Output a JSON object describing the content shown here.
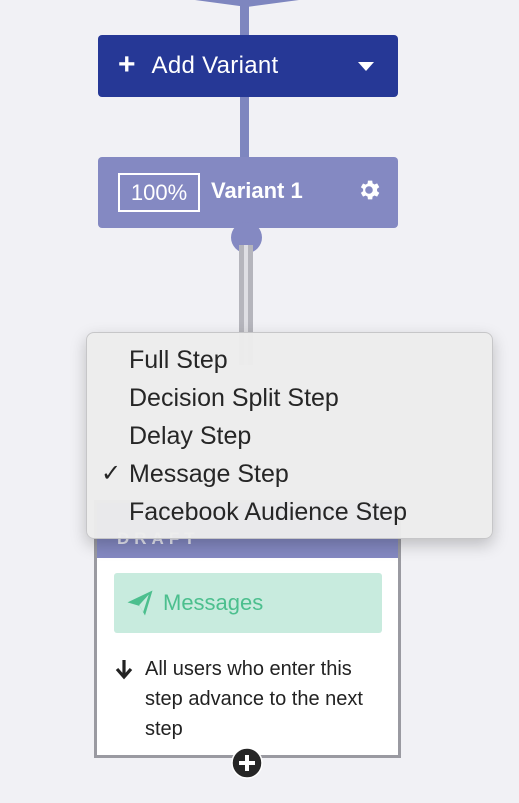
{
  "add_variant": {
    "label": "Add Variant",
    "icon": "plus-icon",
    "dropdown_icon": "caret-down-icon"
  },
  "variant": {
    "percent": "100%",
    "name": "Variant 1",
    "settings_icon": "gear-icon"
  },
  "step_card": {
    "status": "DRAFT",
    "pill_label": "Messages",
    "pill_icon": "paper-plane-icon",
    "note": "All users who enter this step advance to the next step",
    "note_icon": "arrow-down-icon"
  },
  "step_type_menu": {
    "items": [
      {
        "label": "Full Step",
        "checked": false
      },
      {
        "label": "Decision Split Step",
        "checked": false
      },
      {
        "label": "Delay Step",
        "checked": false
      },
      {
        "label": "Message Step",
        "checked": true
      },
      {
        "label": "Facebook Audience Step",
        "checked": false
      }
    ],
    "check_mark": "✓"
  },
  "colors": {
    "background": "#f1f1f5",
    "primary_button": "#263896",
    "variant_card": "#8489c2",
    "messages_pill": "#c8ebde",
    "messages_text": "#4cbf8e"
  }
}
